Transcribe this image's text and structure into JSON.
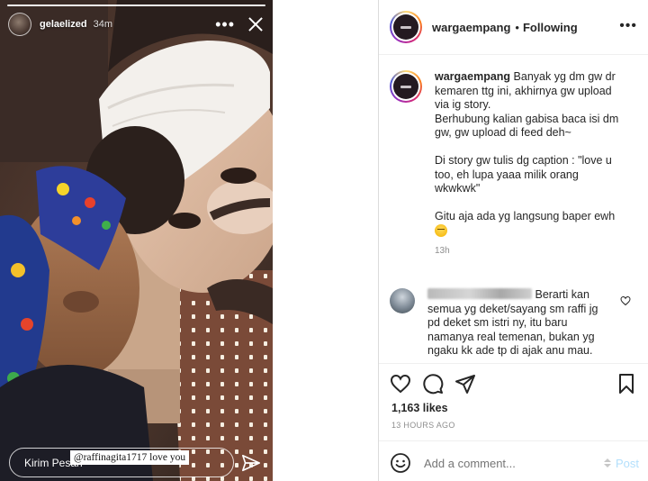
{
  "story": {
    "username": "gelaelized",
    "time": "34m",
    "more_label": "•••",
    "mention": "@raffinagita1717 love you",
    "reply_placeholder": "Kirim Pesan",
    "icons": [
      "more-icon",
      "close-icon",
      "send-icon"
    ]
  },
  "post": {
    "header": {
      "username": "wargaempang",
      "separator": "•",
      "follow_state": "Following",
      "more_label": "•••"
    },
    "caption": {
      "username": "wargaempang",
      "lines": [
        "Banyak yg dm gw dr kemaren ttg ini, akhirnya gw upload via ig story.",
        "Berhubung kalian gabisa baca isi dm gw, gw upload di feed deh~",
        "Di story gw tulis dg caption : \"love u too, eh lupa yaaa milik orang wkwkwk\"",
        "Gitu aja ada yg langsung baper ewh"
      ],
      "emoji": "face-with-rolling-eyes-emoji",
      "time": "13h"
    },
    "comment": {
      "text": "Berarti kan semua yg deket/sayang sm raffi jg pd deket sm istri ny, itu baru namanya real temenan, bukan yg ngaku kk ade tp di ajak anu mau."
    },
    "likes": "1,163 likes",
    "posted_ago": "13 HOURS AGO",
    "add_comment": {
      "placeholder": "Add a comment...",
      "post_label": "Post"
    },
    "icons": [
      "heart-icon",
      "comment-icon",
      "share-icon",
      "bookmark-icon",
      "smile-icon"
    ]
  },
  "colors": {
    "text": "#262626",
    "muted": "#8e8e8e",
    "post_button": "#b2dffc",
    "divider": "#efefef"
  }
}
